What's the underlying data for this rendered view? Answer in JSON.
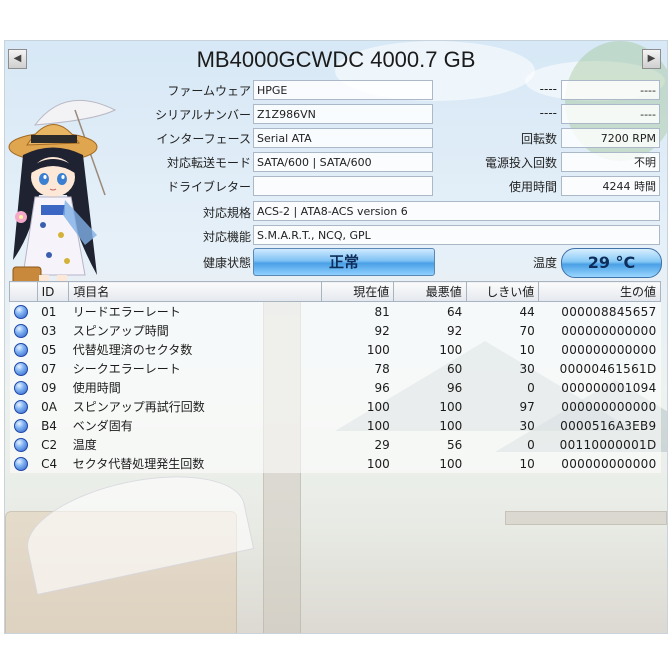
{
  "title": "MB4000GCWDC 4000.7 GB",
  "nav": {
    "prev": "◀",
    "next": "▶"
  },
  "info_left": [
    {
      "label": "ファームウェア",
      "value": "HPGE"
    },
    {
      "label": "シリアルナンバー",
      "value": "Z1Z986VN"
    },
    {
      "label": "インターフェース",
      "value": "Serial ATA"
    },
    {
      "label": "対応転送モード",
      "value": "SATA/600 | SATA/600"
    },
    {
      "label": "ドライブレター",
      "value": ""
    }
  ],
  "info_right": [
    {
      "label": "----",
      "value": "----"
    },
    {
      "label": "----",
      "value": "----"
    },
    {
      "label": "回転数",
      "value": "7200 RPM"
    },
    {
      "label": "電源投入回数",
      "value": "不明"
    },
    {
      "label": "使用時間",
      "value": "4244 時間"
    }
  ],
  "standard": {
    "label": "対応規格",
    "value": "ACS-2 | ATA8-ACS version 6"
  },
  "features": {
    "label": "対応機能",
    "value": "S.M.A.R.T., NCQ, GPL"
  },
  "health": {
    "label": "健康状態",
    "value": "正常"
  },
  "temperature": {
    "label": "温度",
    "value": "29 °C"
  },
  "smart_table": {
    "headers": [
      "",
      "ID",
      "項目名",
      "現在値",
      "最悪値",
      "しきい値",
      "生の値"
    ],
    "rows": [
      {
        "id": "01",
        "name": "リードエラーレート",
        "current": "81",
        "worst": "64",
        "threshold": "44",
        "raw": "000008845657"
      },
      {
        "id": "03",
        "name": "スピンアップ時間",
        "current": "92",
        "worst": "92",
        "threshold": "70",
        "raw": "000000000000"
      },
      {
        "id": "05",
        "name": "代替処理済のセクタ数",
        "current": "100",
        "worst": "100",
        "threshold": "10",
        "raw": "000000000000"
      },
      {
        "id": "07",
        "name": "シークエラーレート",
        "current": "78",
        "worst": "60",
        "threshold": "30",
        "raw": "00000461561D"
      },
      {
        "id": "09",
        "name": "使用時間",
        "current": "96",
        "worst": "96",
        "threshold": "0",
        "raw": "000000001094"
      },
      {
        "id": "0A",
        "name": "スピンアップ再試行回数",
        "current": "100",
        "worst": "100",
        "threshold": "97",
        "raw": "000000000000"
      },
      {
        "id": "B4",
        "name": "ベンダ固有",
        "current": "100",
        "worst": "100",
        "threshold": "30",
        "raw": "0000516A3EB9"
      },
      {
        "id": "C2",
        "name": "温度",
        "current": "29",
        "worst": "56",
        "threshold": "0",
        "raw": "00110000001D"
      },
      {
        "id": "C4",
        "name": "セクタ代替処理発生回数",
        "current": "100",
        "worst": "100",
        "threshold": "10",
        "raw": "000000000000"
      }
    ]
  },
  "colors": {
    "health_good": "#4aa0e6",
    "status_dot": "#2f5fc8"
  }
}
